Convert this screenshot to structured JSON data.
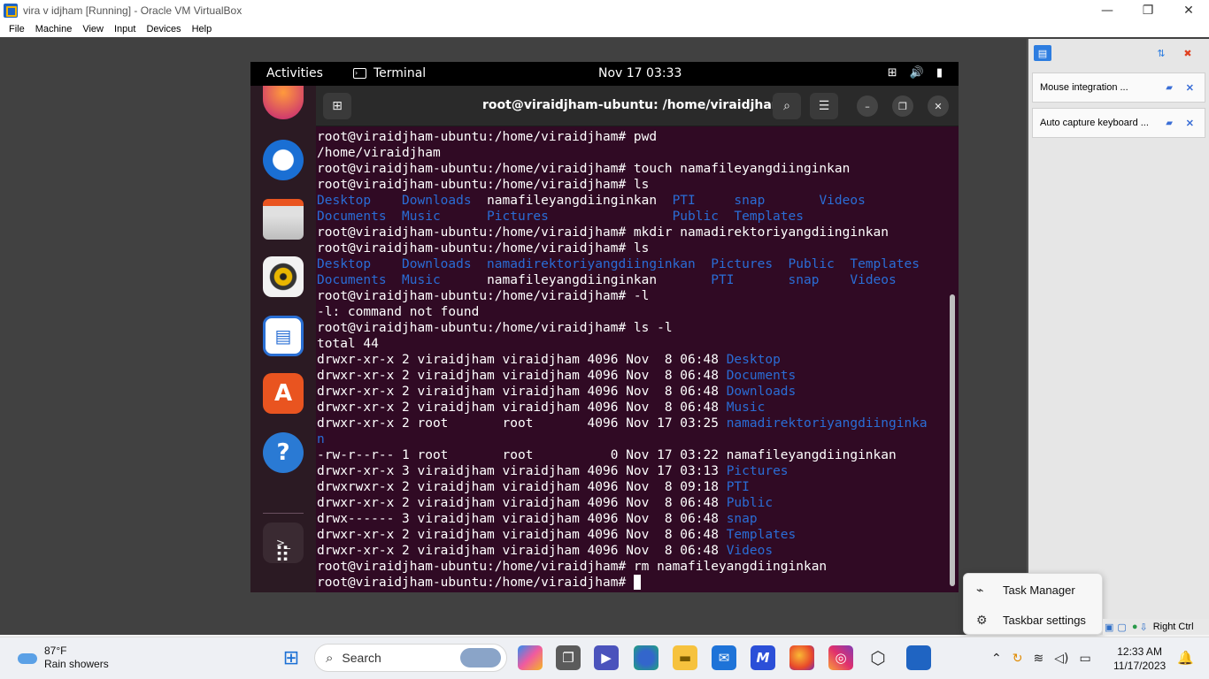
{
  "window": {
    "title": "vira v idjham  [Running] - Oracle VM VirtualBox",
    "minimize": "—",
    "maximize": "❐",
    "close": "✕"
  },
  "menu": [
    "File",
    "Machine",
    "View",
    "Input",
    "Devices",
    "Help"
  ],
  "side_panel": {
    "notifications": [
      {
        "text": "Mouse integration ..."
      },
      {
        "text": "Auto capture keyboard ..."
      }
    ]
  },
  "ubuntu": {
    "topbar": {
      "activities": "Activities",
      "app": "Terminal",
      "clock": "Nov 17  03:33"
    },
    "terminal": {
      "title": "root@viraidjham-ubuntu: /home/viraidjham",
      "prompt": "root@viraidjham-ubuntu:/home/viraidjham#"
    }
  },
  "context_menu": {
    "task_manager": "Task Manager",
    "taskbar_settings": "Taskbar settings"
  },
  "vbox_status": {
    "host_key": "Right Ctrl"
  },
  "taskbar": {
    "weather_temp": "87°F",
    "weather_desc": "Rain showers",
    "search_label": "Search",
    "time": "12:33 AM",
    "date": "11/17/2023"
  },
  "colors": {
    "terminal_bg": "#300a24",
    "dir_blue": "#2a6dd6",
    "ubuntu_orange": "#e95420"
  },
  "terminal_lines": [
    {
      "c": "p",
      "t": "root@viraidjham-ubuntu:/home/viraidjham# pwd"
    },
    {
      "c": "w",
      "t": "/home/viraidjham"
    },
    {
      "c": "p",
      "t": "root@viraidjham-ubuntu:/home/viraidjham# touch namafileyangdiinginkan"
    },
    {
      "c": "p",
      "t": "root@viraidjham-ubuntu:/home/viraidjham# ls"
    },
    {
      "c": "ls1",
      "parts": [
        [
          "b",
          "Desktop    Downloads  "
        ],
        [
          "w",
          "namafileyangdiinginkan  "
        ],
        [
          "b",
          "PTI     snap       Videos"
        ]
      ]
    },
    {
      "c": "ls1",
      "parts": [
        [
          "b",
          "Documents  Music      Pictures                Public  Templates"
        ]
      ]
    },
    {
      "c": "p",
      "t": "root@viraidjham-ubuntu:/home/viraidjham# mkdir namadirektoriyangdiinginkan"
    },
    {
      "c": "p",
      "t": "root@viraidjham-ubuntu:/home/viraidjham# ls"
    },
    {
      "c": "ls1",
      "parts": [
        [
          "b",
          "Desktop    Downloads  namadirektoriyangdiinginkan  Pictures  Public  Templates"
        ]
      ]
    },
    {
      "c": "ls1",
      "parts": [
        [
          "b",
          "Documents  Music      "
        ],
        [
          "w",
          "namafileyangdiinginkan       "
        ],
        [
          "b",
          "PTI       snap    Videos"
        ]
      ]
    },
    {
      "c": "p",
      "t": "root@viraidjham-ubuntu:/home/viraidjham# -l"
    },
    {
      "c": "w",
      "t": "-l: command not found"
    },
    {
      "c": "p",
      "t": "root@viraidjham-ubuntu:/home/viraidjham# ls -l"
    },
    {
      "c": "w",
      "t": "total 44"
    },
    {
      "c": "ls1",
      "parts": [
        [
          "w",
          "drwxr-xr-x 2 viraidjham viraidjham 4096 Nov  8 06:48 "
        ],
        [
          "b",
          "Desktop"
        ]
      ]
    },
    {
      "c": "ls1",
      "parts": [
        [
          "w",
          "drwxr-xr-x 2 viraidjham viraidjham 4096 Nov  8 06:48 "
        ],
        [
          "b",
          "Documents"
        ]
      ]
    },
    {
      "c": "ls1",
      "parts": [
        [
          "w",
          "drwxr-xr-x 2 viraidjham viraidjham 4096 Nov  8 06:48 "
        ],
        [
          "b",
          "Downloads"
        ]
      ]
    },
    {
      "c": "ls1",
      "parts": [
        [
          "w",
          "drwxr-xr-x 2 viraidjham viraidjham 4096 Nov  8 06:48 "
        ],
        [
          "b",
          "Music"
        ]
      ]
    },
    {
      "c": "ls1",
      "parts": [
        [
          "w",
          "drwxr-xr-x 2 root       root       4096 Nov 17 03:25 "
        ],
        [
          "b",
          "namadirektoriyangdiinginka"
        ]
      ]
    },
    {
      "c": "ls1",
      "parts": [
        [
          "b",
          "n"
        ]
      ]
    },
    {
      "c": "w",
      "t": "-rw-r--r-- 1 root       root          0 Nov 17 03:22 namafileyangdiinginkan"
    },
    {
      "c": "ls1",
      "parts": [
        [
          "w",
          "drwxr-xr-x 3 viraidjham viraidjham 4096 Nov 17 03:13 "
        ],
        [
          "b",
          "Pictures"
        ]
      ]
    },
    {
      "c": "ls1",
      "parts": [
        [
          "w",
          "drwxrwxr-x 2 viraidjham viraidjham 4096 Nov  8 09:18 "
        ],
        [
          "b",
          "PTI"
        ]
      ]
    },
    {
      "c": "ls1",
      "parts": [
        [
          "w",
          "drwxr-xr-x 2 viraidjham viraidjham 4096 Nov  8 06:48 "
        ],
        [
          "b",
          "Public"
        ]
      ]
    },
    {
      "c": "ls1",
      "parts": [
        [
          "w",
          "drwx------ 3 viraidjham viraidjham 4096 Nov  8 06:48 "
        ],
        [
          "b",
          "snap"
        ]
      ]
    },
    {
      "c": "ls1",
      "parts": [
        [
          "w",
          "drwxr-xr-x 2 viraidjham viraidjham 4096 Nov  8 06:48 "
        ],
        [
          "b",
          "Templates"
        ]
      ]
    },
    {
      "c": "ls1",
      "parts": [
        [
          "w",
          "drwxr-xr-x 2 viraidjham viraidjham 4096 Nov  8 06:48 "
        ],
        [
          "b",
          "Videos"
        ]
      ]
    },
    {
      "c": "p",
      "t": "root@viraidjham-ubuntu:/home/viraidjham# rm namafileyangdiinginkan"
    },
    {
      "c": "cur",
      "t": "root@viraidjham-ubuntu:/home/viraidjham# "
    }
  ]
}
